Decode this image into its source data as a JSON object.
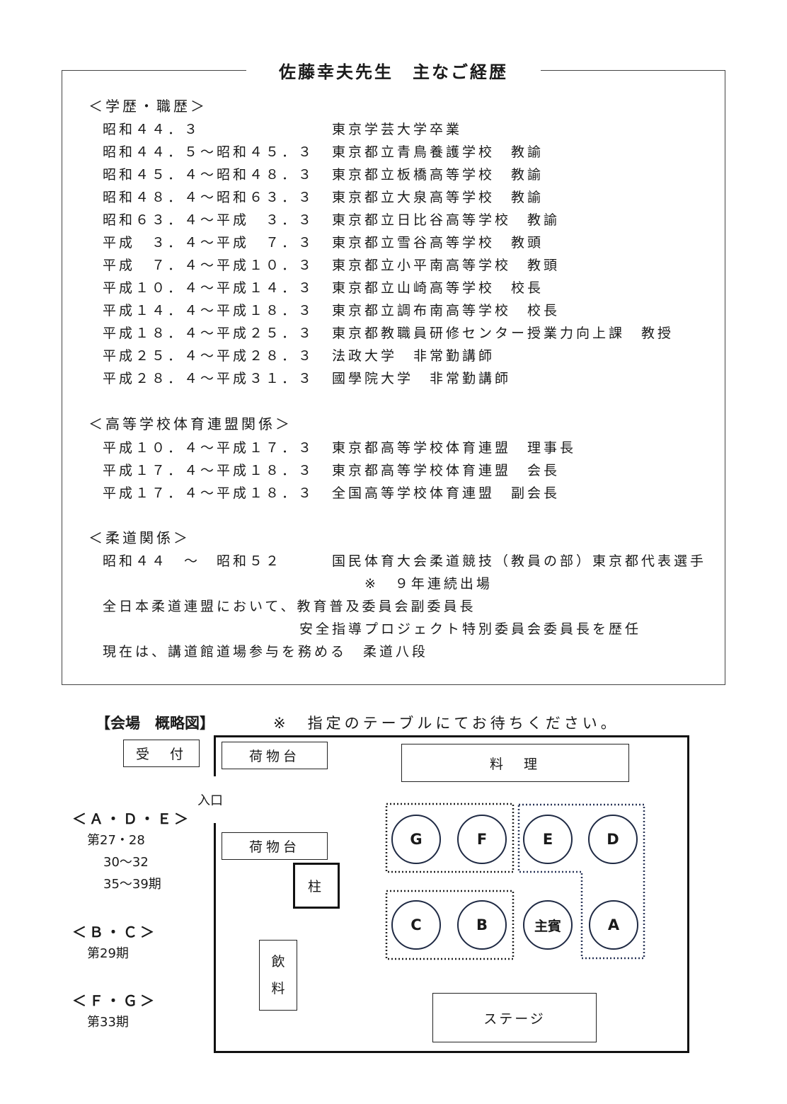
{
  "bio": {
    "title": "佐藤幸夫先生　主なご経歴",
    "sections": [
      {
        "heading": "＜学歴・職歴＞",
        "rows": [
          {
            "date": "昭和４４．３",
            "position": "東京学芸大学卒業"
          },
          {
            "date": "昭和４４．５～昭和４５．３",
            "position": "東京都立青鳥養護学校　教諭"
          },
          {
            "date": "昭和４５．４～昭和４８．３",
            "position": "東京都立板橋高等学校　教諭"
          },
          {
            "date": "昭和４８．４～昭和６３．３",
            "position": "東京都立大泉高等学校　教諭"
          },
          {
            "date": "昭和６３．４～平成　３．３",
            "position": "東京都立日比谷高等学校　教諭"
          },
          {
            "date": "平成　３．４～平成　７．３",
            "position": "東京都立雪谷高等学校　教頭"
          },
          {
            "date": "平成　７．４～平成１０．３",
            "position": "東京都立小平南高等学校　教頭"
          },
          {
            "date": "平成１０．４～平成１４．３",
            "position": "東京都立山崎高等学校　校長"
          },
          {
            "date": "平成１４．４～平成１８．３",
            "position": "東京都立調布南高等学校　校長"
          },
          {
            "date": "平成１８．４～平成２５．３",
            "position": "東京都教職員研修センター授業力向上課　教授"
          },
          {
            "date": "平成２５．４～平成２８．３",
            "position": "法政大学　非常勤講師"
          },
          {
            "date": "平成２８．４～平成３１．３",
            "position": "國學院大学　非常勤講師"
          }
        ]
      },
      {
        "heading": "＜高等学校体育連盟関係＞",
        "rows": [
          {
            "date": "平成１０．４～平成１７．３",
            "position": "東京都高等学校体育連盟　理事長"
          },
          {
            "date": "平成１７．４～平成１８．３",
            "position": "東京都高等学校体育連盟　会長"
          },
          {
            "date": "平成１７．４～平成１８．３",
            "position": "全国高等学校体育連盟　副会長"
          }
        ]
      },
      {
        "heading": "＜柔道関係＞",
        "rows": [
          {
            "date": "昭和４４　～　昭和５２",
            "position": "国民体育大会柔道競技（教員の部）東京都代表選手"
          }
        ],
        "note": "※　９年連続出場",
        "lines": [
          "全日本柔道連盟において、教育普及委員会副委員長",
          "安全指導プロジェクト特別委員会委員長を歴任",
          "現在は、講道館道場参与を務める　柔道八段"
        ]
      }
    ]
  },
  "venue": {
    "title": "【会場　概略図】",
    "notice": "※　指定のテーブルにてお待ちください。",
    "reception": "受　付",
    "luggage_top": "荷物台",
    "luggage_bottom": "荷物台",
    "food": "料　理",
    "entrance": "入口",
    "pillar": "柱",
    "drink_1": "飲",
    "drink_2": "料",
    "stage": "ステージ",
    "tables": {
      "G": "G",
      "F": "F",
      "E": "E",
      "D": "D",
      "C": "C",
      "B": "B",
      "guest": "主賓",
      "A": "A"
    },
    "legend": [
      {
        "title": "＜Ａ・Ｄ・Ｅ＞",
        "lines": [
          "第27・28",
          "30～32",
          "35～39期"
        ]
      },
      {
        "title": "＜Ｂ・Ｃ＞",
        "lines": [
          "第29期"
        ]
      },
      {
        "title": "＜Ｆ・Ｇ＞",
        "lines": [
          "第33期"
        ]
      }
    ]
  }
}
